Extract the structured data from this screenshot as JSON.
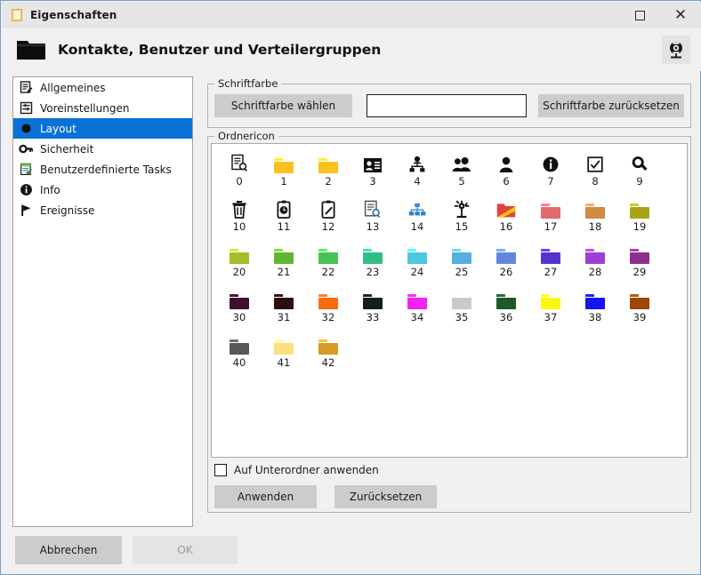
{
  "window": {
    "title": "Eigenschaften",
    "title_icon": "document-icon",
    "maximize_label": "maximize-icon",
    "close_label": "close-icon"
  },
  "header": {
    "icon": "folder-icon",
    "title": "Kontakte, Benutzer und Verteilergruppen",
    "help_icon": "help-compass-icon"
  },
  "sidebar": {
    "items": [
      {
        "label": "Allgemeines",
        "icon": "document-edit-icon",
        "selected": false
      },
      {
        "label": "Voreinstellungen",
        "icon": "sliders-icon",
        "selected": false
      },
      {
        "label": "Layout",
        "icon": "circle-icon",
        "selected": true
      },
      {
        "label": "Sicherheit",
        "icon": "key-icon",
        "selected": false
      },
      {
        "label": "Benutzerdefinierte Tasks",
        "icon": "task-note-icon",
        "selected": false
      },
      {
        "label": "Info",
        "icon": "info-icon",
        "selected": false
      },
      {
        "label": "Ereignisse",
        "icon": "flag-icon",
        "selected": false
      }
    ]
  },
  "font_color_group": {
    "legend": "Schriftfarbe",
    "pick_button": "Schriftfarbe wählen",
    "reset_button": "Schriftfarbe zurücksetzen",
    "preview_color": "#ffffff"
  },
  "folder_icon_group": {
    "legend": "Ordnericon",
    "apply_subfolders_label": "Auf Unterordner anwenden",
    "apply_subfolders_checked": false,
    "apply_button": "Anwenden",
    "reset_button": "Zurücksetzen",
    "icons": [
      {
        "n": "0",
        "kind": "glyph",
        "icon": "document-search-icon"
      },
      {
        "n": "1",
        "kind": "folder",
        "icon": "folder-icon",
        "color": "#fcc020",
        "tab": "#fcc020"
      },
      {
        "n": "2",
        "kind": "folder",
        "icon": "folder-icon",
        "color": "#fcc020",
        "tab": "#fcc020"
      },
      {
        "n": "3",
        "kind": "glyph",
        "icon": "contact-card-icon"
      },
      {
        "n": "4",
        "kind": "glyph",
        "icon": "org-chart-icon"
      },
      {
        "n": "5",
        "kind": "glyph",
        "icon": "users-icon"
      },
      {
        "n": "6",
        "kind": "glyph",
        "icon": "user-icon"
      },
      {
        "n": "7",
        "kind": "glyph",
        "icon": "info-icon"
      },
      {
        "n": "8",
        "kind": "glyph",
        "icon": "checkbox-icon"
      },
      {
        "n": "9",
        "kind": "glyph",
        "icon": "search-icon"
      },
      {
        "n": "10",
        "kind": "glyph",
        "icon": "trash-icon"
      },
      {
        "n": "11",
        "kind": "glyph",
        "icon": "clipboard-clock-icon"
      },
      {
        "n": "12",
        "kind": "glyph",
        "icon": "clipboard-edit-icon"
      },
      {
        "n": "13",
        "kind": "glyph",
        "icon": "document-preview-icon"
      },
      {
        "n": "14",
        "kind": "glyph",
        "icon": "hierarchy-blue-icon"
      },
      {
        "n": "15",
        "kind": "glyph",
        "icon": "node-star-icon"
      },
      {
        "n": "16",
        "kind": "glyph",
        "icon": "folder-open-orange-icon"
      },
      {
        "n": "17",
        "kind": "folder",
        "icon": "folder-icon",
        "color": "#e06a6e",
        "tab": "#e06a6e"
      },
      {
        "n": "18",
        "kind": "folder",
        "icon": "folder-icon",
        "color": "#d08a44",
        "tab": "#d08a44"
      },
      {
        "n": "19",
        "kind": "folder",
        "icon": "folder-icon",
        "color": "#a8a318",
        "tab": "#a8a318"
      },
      {
        "n": "20",
        "kind": "folder",
        "icon": "folder-icon",
        "color": "#a8bb2a",
        "tab": "#a8bb2a"
      },
      {
        "n": "21",
        "kind": "folder",
        "icon": "folder-icon",
        "color": "#5fb731",
        "tab": "#5fb731"
      },
      {
        "n": "22",
        "kind": "folder",
        "icon": "folder-icon",
        "color": "#47c355",
        "tab": "#47c355"
      },
      {
        "n": "23",
        "kind": "folder",
        "icon": "folder-icon",
        "color": "#33bd86",
        "tab": "#33bd86"
      },
      {
        "n": "24",
        "kind": "folder",
        "icon": "folder-icon",
        "color": "#4cc7de",
        "tab": "#4cc7de"
      },
      {
        "n": "25",
        "kind": "folder",
        "icon": "folder-icon",
        "color": "#57aee0",
        "tab": "#57aee0"
      },
      {
        "n": "26",
        "kind": "folder",
        "icon": "folder-icon",
        "color": "#6387e0",
        "tab": "#6387e0"
      },
      {
        "n": "27",
        "kind": "folder",
        "icon": "folder-icon",
        "color": "#5433d1",
        "tab": "#5433d1"
      },
      {
        "n": "28",
        "kind": "folder",
        "icon": "folder-icon",
        "color": "#9b3fd6",
        "tab": "#9b3fd6"
      },
      {
        "n": "29",
        "kind": "folder",
        "icon": "folder-icon",
        "color": "#8e2f8e",
        "tab": "#8e2f8e"
      },
      {
        "n": "30",
        "kind": "folder",
        "icon": "folder-icon",
        "color": "#411030",
        "tab": "#411030"
      },
      {
        "n": "31",
        "kind": "folder",
        "icon": "folder-icon",
        "color": "#2d0f12",
        "tab": "#2d0f12"
      },
      {
        "n": "32",
        "kind": "folder",
        "icon": "folder-icon",
        "color": "#fc6a10",
        "tab": "#fc6a10"
      },
      {
        "n": "33",
        "kind": "folder",
        "icon": "folder-icon",
        "color": "#141f1c",
        "tab": "#141f1c"
      },
      {
        "n": "34",
        "kind": "folder",
        "icon": "folder-icon",
        "color": "#f420f4",
        "tab": "#f420f4"
      },
      {
        "n": "35",
        "kind": "folder",
        "icon": "folder-icon",
        "color": "#c9c9c9",
        "tab": "#c9c9c9"
      },
      {
        "n": "36",
        "kind": "folder",
        "icon": "folder-icon",
        "color": "#1e5a28",
        "tab": "#1e5a28"
      },
      {
        "n": "37",
        "kind": "folder",
        "icon": "folder-icon",
        "color": "#f7f712",
        "tab": "#f7f712"
      },
      {
        "n": "38",
        "kind": "folder",
        "icon": "folder-icon",
        "color": "#1515f0",
        "tab": "#1515f0"
      },
      {
        "n": "39",
        "kind": "folder",
        "icon": "folder-icon",
        "color": "#9c4608",
        "tab": "#9c4608"
      },
      {
        "n": "40",
        "kind": "folder",
        "icon": "folder-icon",
        "color": "#56595a",
        "tab": "#56595a"
      },
      {
        "n": "41",
        "kind": "folder",
        "icon": "folder-icon",
        "color": "#fae07a",
        "tab": "#fae07a"
      },
      {
        "n": "42",
        "kind": "folder",
        "icon": "folder-icon",
        "color": "#d69a28",
        "tab": "#d69a28"
      }
    ]
  },
  "footer": {
    "cancel_button": "Abbrechen",
    "ok_button": "OK",
    "ok_disabled": true
  }
}
